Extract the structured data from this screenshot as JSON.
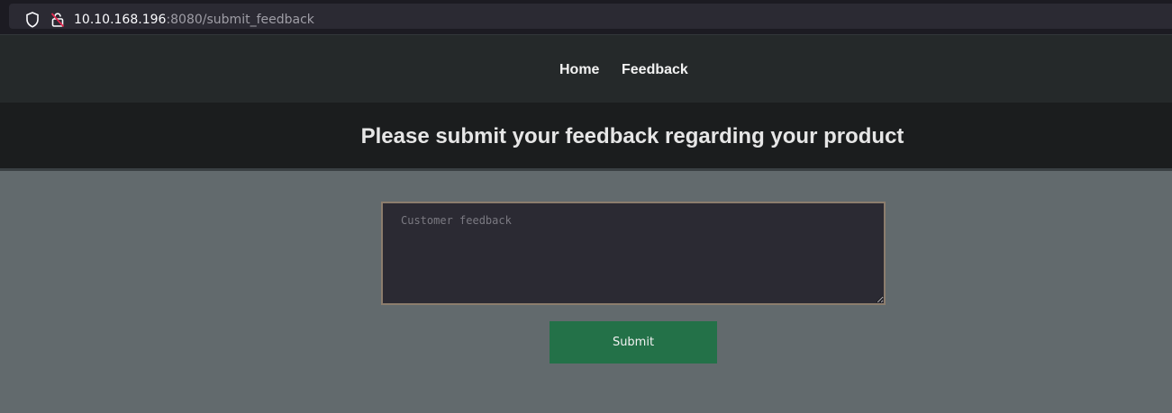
{
  "browser": {
    "url_host": "10.10.168.196",
    "url_rest": ":8080/submit_feedback"
  },
  "nav": {
    "home_label": "Home",
    "feedback_label": "Feedback"
  },
  "banner": {
    "title": "Please submit your feedback regarding your product"
  },
  "form": {
    "feedback_value": "",
    "feedback_placeholder": "Customer feedback",
    "submit_label": "Submit"
  },
  "icons": {
    "shield": "shield-icon",
    "lock": "insecure-lock-icon"
  },
  "colors": {
    "page_bg": "#626a6d",
    "nav_bg": "#25292a",
    "banner_bg": "#1b1d1e",
    "submit_bg": "#237148",
    "textarea_bg": "#2b2a33",
    "textarea_border": "#8c7d6d"
  }
}
